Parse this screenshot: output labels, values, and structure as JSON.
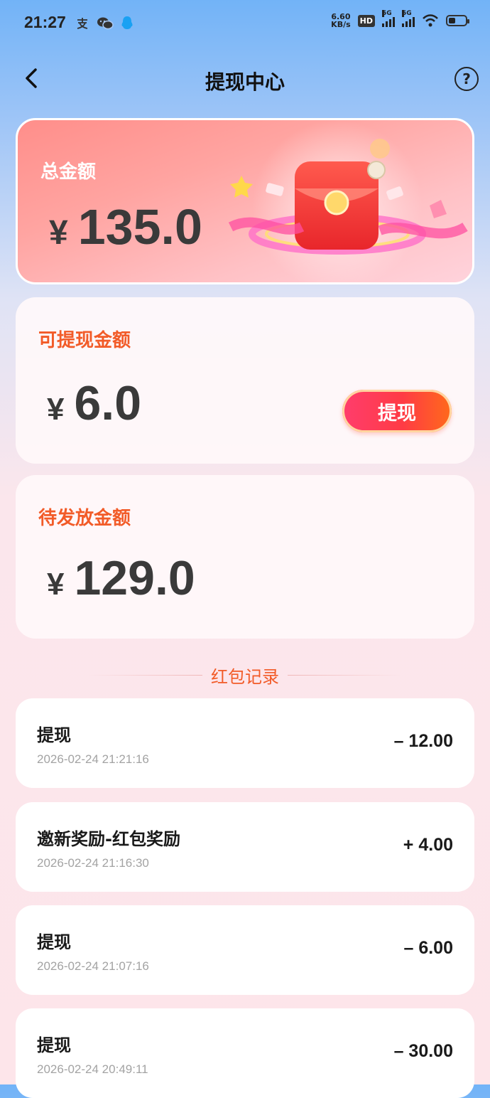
{
  "status_bar": {
    "time": "21:27",
    "net_speed_value": "6.60",
    "net_speed_unit": "KB/s",
    "hd_label": "HD",
    "sim1_label": "5G",
    "sim2_label": "5G",
    "battery_level": 0.35
  },
  "header": {
    "title": "提现中心",
    "help_glyph": "?"
  },
  "total_card": {
    "label": "总金额",
    "currency": "¥",
    "amount": "135.0"
  },
  "available_card": {
    "label": "可提现金额",
    "currency": "¥",
    "amount": "6.0",
    "button_label": "提现"
  },
  "pending_card": {
    "label": "待发放金额",
    "currency": "¥",
    "amount": "129.0"
  },
  "records_section": {
    "title": "红包记录",
    "items": [
      {
        "title": "提现",
        "time": "2026-02-24 21:21:16",
        "amount": "– 12.00"
      },
      {
        "title": "邀新奖励-红包奖励",
        "time": "2026-02-24 21:16:30",
        "amount": "+ 4.00"
      },
      {
        "title": "提现",
        "time": "2026-02-24 21:07:16",
        "amount": "– 6.00"
      },
      {
        "title": "提现",
        "time": "2026-02-24 20:49:11",
        "amount": "– 30.00"
      }
    ]
  },
  "colors": {
    "accent_orange": "#f25b28",
    "button_gradient_start": "#ff3d6d",
    "button_gradient_end": "#ff6a1a",
    "total_card_pink": "#ff9c98"
  }
}
